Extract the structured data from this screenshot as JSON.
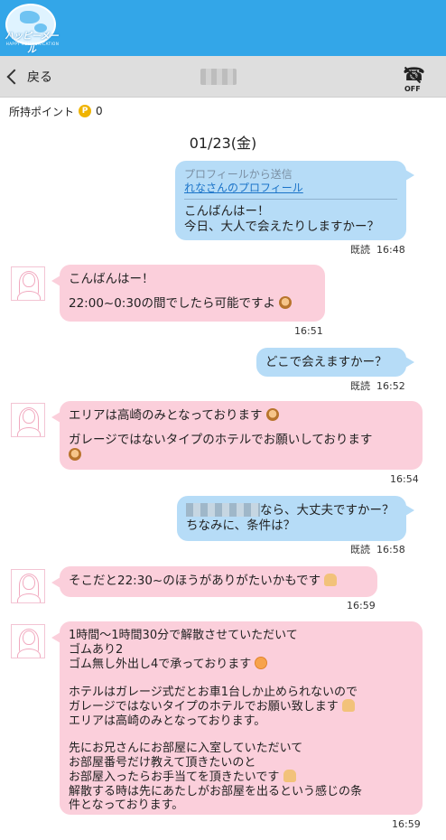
{
  "app": {
    "logo_text": "ハッピーメール",
    "logo_sub": "HAPPY COMMUNICATION"
  },
  "nav": {
    "back_label": "戻る",
    "call_status": "OFF"
  },
  "points": {
    "label": "所持ポイント",
    "coin_symbol": "P",
    "value": "0"
  },
  "date": "01/23(金)",
  "messages": [
    {
      "profile_header": "プロフィールから送信",
      "profile_link": "れなさんのプロフィール",
      "line1": "こんばんはー！",
      "line2": "今日、大人で会えたりしますかー？",
      "read": "既読",
      "time": "16:48"
    },
    {
      "line1": "こんばんはー！",
      "line2": "22:00~0:30の間でしたら可能ですよ",
      "time": "16:51"
    },
    {
      "line1": "どこで会えますかー？",
      "read": "既読",
      "time": "16:52"
    },
    {
      "line1": "エリアは高崎のみとなっております",
      "line2": "ガレージではないタイプのホテルでお願いしております",
      "time": "16:54"
    },
    {
      "line1": "なら、大丈夫ですかー？",
      "line2": "ちなみに、条件は？",
      "read": "既読",
      "time": "16:58"
    },
    {
      "line1": "そこだと22:30~のほうがありがたいかもです",
      "time": "16:59"
    },
    {
      "l1": "1時間～1時間30分で解散させていただいて",
      "l2": "ゴムあり2",
      "l3": "ゴム無し外出し4で承っております",
      "l4": "ホテルはガレージ式だとお車1台しか止められないので",
      "l5": "ガレージではないタイプのホテルでお願い致します",
      "l6": "エリアは高崎のみとなっております。",
      "l7": "先にお兄さんにお部屋に入室していただいて",
      "l8": "お部屋番号だけ教えて頂きたいのと",
      "l9": "お部屋入ったらお手当てを頂きたいです",
      "l10": "解散する時は先にあたしがお部屋を出るという感じの条",
      "l11": "件となっております。",
      "time": "16:59"
    }
  ],
  "colors": {
    "header_blue": "#33a6e8",
    "nav_gray": "#dedede",
    "outgoing_bubble": "#b6dcf7",
    "incoming_bubble": "#fbcfdb",
    "coin": "#f0b400",
    "link": "#1a73c8"
  },
  "icons": [
    "logo-globe",
    "chevron-left-icon",
    "phone-off-icon",
    "coin-icon",
    "avatar-icon",
    "emoji-woman-icon",
    "emoji-pray-hands-icon",
    "emoji-smile-icon",
    "emoji-raised-hands-icon"
  ]
}
